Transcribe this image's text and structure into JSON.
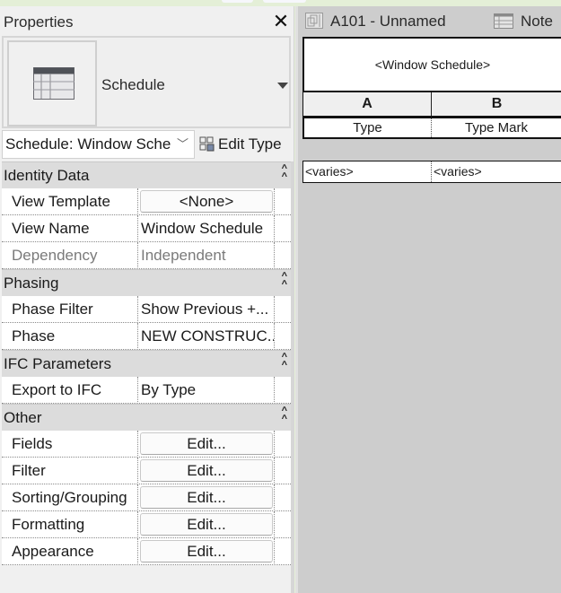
{
  "properties": {
    "title": "Properties",
    "type_selector": {
      "icon": "schedule-table-icon",
      "type_name": "Schedule"
    },
    "instance_selector": "Schedule: Window Sche",
    "edit_type_label": "Edit Type",
    "groups": [
      {
        "label": "Identity Data",
        "rows": [
          {
            "label": "View Template",
            "value": "<None>",
            "kind": "button"
          },
          {
            "label": "View Name",
            "value": "Window Schedule",
            "kind": "text"
          },
          {
            "label": "Dependency",
            "value": "Independent",
            "kind": "disabled"
          }
        ]
      },
      {
        "label": "Phasing",
        "rows": [
          {
            "label": "Phase Filter",
            "value": "Show Previous +...",
            "kind": "text"
          },
          {
            "label": "Phase",
            "value": "NEW CONSTRUC...",
            "kind": "text"
          }
        ]
      },
      {
        "label": "IFC Parameters",
        "rows": [
          {
            "label": "Export to IFC",
            "value": "By Type",
            "kind": "text"
          }
        ]
      },
      {
        "label": "Other",
        "rows": [
          {
            "label": "Fields",
            "value": "Edit...",
            "kind": "button"
          },
          {
            "label": "Filter",
            "value": "Edit...",
            "kind": "button"
          },
          {
            "label": "Sorting/Grouping",
            "value": "Edit...",
            "kind": "button"
          },
          {
            "label": "Formatting",
            "value": "Edit...",
            "kind": "button"
          },
          {
            "label": "Appearance",
            "value": "Edit...",
            "kind": "button"
          }
        ]
      }
    ]
  },
  "view_tabs": [
    {
      "label": "A101 - Unnamed",
      "icon": "sheet-icon"
    },
    {
      "label": "Note",
      "icon": "schedule-icon"
    }
  ],
  "schedule": {
    "title": "<Window Schedule>",
    "column_letters": [
      "A",
      "B"
    ],
    "field_headers": [
      "Type",
      "Type Mark"
    ],
    "rows": [
      [
        "<varies>",
        "<varies>"
      ]
    ]
  }
}
